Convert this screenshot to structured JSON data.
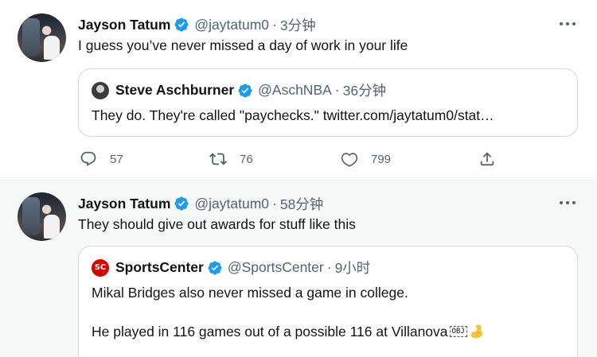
{
  "tweets": [
    {
      "author": "Jayson Tatum",
      "handle": "@jaytatum0",
      "time": "3分钟",
      "text": "I guess you’ve never missed a day of work in your life",
      "quote": {
        "author": "Steve Aschburner",
        "handle": "@AschNBA",
        "time": "36分钟",
        "text": "They do. They're called \"paychecks.\" twitter.com/jaytatum0/stat…"
      },
      "actions": {
        "replies": "57",
        "retweets": "76",
        "likes": "799"
      }
    },
    {
      "author": "Jayson Tatum",
      "handle": "@jaytatum0",
      "time": "58分钟",
      "text": "They should give out awards for stuff like this",
      "quote": {
        "author": "SportsCenter",
        "handle": "@SportsCenter",
        "time": "9小时",
        "avatar_text": "SC",
        "line1": "Mikal Bridges also never missed a game in college.",
        "line2": "He played in 116 games out of a possible 116 at Villanova",
        "obj_marker": "OBJ"
      }
    }
  ],
  "separator": "·",
  "icons": {
    "verified": "verified-badge-icon",
    "more": "more-options-icon",
    "reply": "reply-icon",
    "retweet": "retweet-icon",
    "like": "heart-icon",
    "share": "share-icon",
    "emoji": "flexed-biceps-emoji"
  },
  "colors": {
    "verified_blue": "#1d9bf0",
    "secondary_text": "#536471",
    "border": "#cfd9de",
    "highlight_bg": "#f7f9f9"
  }
}
